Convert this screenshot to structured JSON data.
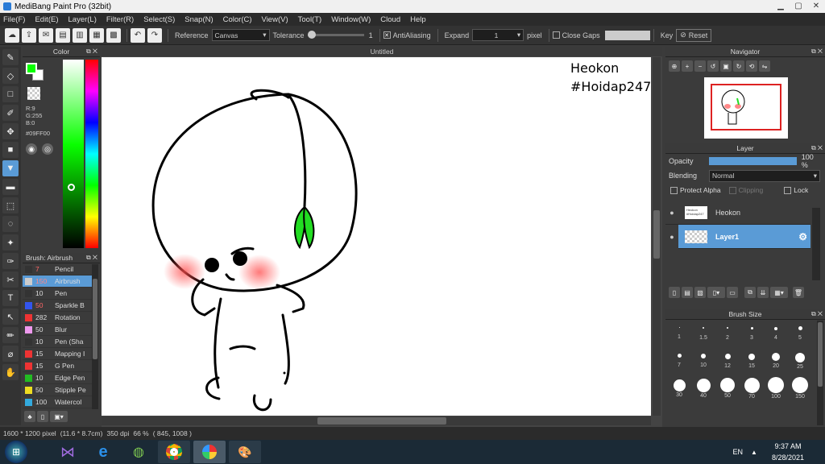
{
  "window": {
    "title": "MediBang Paint Pro (32bit)"
  },
  "menu": [
    "File(F)",
    "Edit(E)",
    "Layer(L)",
    "Filter(R)",
    "Select(S)",
    "Snap(N)",
    "Color(C)",
    "View(V)",
    "Tool(T)",
    "Window(W)",
    "Cloud",
    "Help"
  ],
  "toolbar": {
    "reference_label": "Reference",
    "reference_value": "Canvas",
    "tolerance_label": "Tolerance",
    "tolerance_value": "1",
    "tolerance_fraction": 0.01,
    "antialiasing_label": "AntiAliasing",
    "expand_label": "Expand",
    "expand_value": "1",
    "expand_unit": "pixel",
    "close_gaps_label": "Close Gaps",
    "key_label": "Key",
    "reset_label": "Reset"
  },
  "color_panel": {
    "title": "Color",
    "r": "R:9",
    "g": "G:255",
    "b": "B:0",
    "hex": "#09FF00",
    "current_color": "#09ff00"
  },
  "brush_panel": {
    "title": "Brush: Airbrush",
    "items": [
      {
        "size": "7",
        "name": "Pencil",
        "color": "#333333"
      },
      {
        "size": "150",
        "name": "Airbrush",
        "color": "#cccccc"
      },
      {
        "size": "10",
        "name": "Pen",
        "color": "#333333"
      },
      {
        "size": "50",
        "name": "Sparkle B",
        "color": "#3355ee"
      },
      {
        "size": "282",
        "name": "Rotation",
        "color": "#ee3333"
      },
      {
        "size": "50",
        "name": "Blur",
        "color": "#ee99ee"
      },
      {
        "size": "10",
        "name": "Pen (Sha",
        "color": "#333333"
      },
      {
        "size": "15",
        "name": "Mapping I",
        "color": "#ee3333"
      },
      {
        "size": "15",
        "name": "G Pen",
        "color": "#ee3333"
      },
      {
        "size": "10",
        "name": "Edge Pen",
        "color": "#22bb22"
      },
      {
        "size": "50",
        "name": "Stipple Pe",
        "color": "#eedd22"
      },
      {
        "size": "100",
        "name": "Watercol",
        "color": "#33aadd"
      }
    ]
  },
  "document": {
    "tab": "Untitled",
    "caption_line1": "Heokon",
    "caption_line2": "#Hoidap247"
  },
  "navigator": {
    "title": "Navigator"
  },
  "layer_panel": {
    "title": "Layer",
    "opacity_label": "Opacity",
    "opacity_value": "100 %",
    "opacity_fraction": 1.0,
    "blending_label": "Blending",
    "blending_value": "Normal",
    "protect_alpha": "Protect Alpha",
    "clipping": "Clipping",
    "lock": "Lock",
    "layers": [
      {
        "name": "Heokon",
        "thumb_text": "Heokon #Hoidap247"
      },
      {
        "name": "Layer1"
      }
    ]
  },
  "brush_size_panel": {
    "title": "Brush Size",
    "sizes": [
      "1",
      "1.5",
      "2",
      "3",
      "4",
      "5",
      "7",
      "10",
      "12",
      "15",
      "20",
      "25",
      "30",
      "40",
      "50",
      "70",
      "100",
      "150"
    ]
  },
  "statusbar": {
    "size": "1600 * 1200 pixel",
    "cm": "(11.6 * 8.7cm)",
    "dpi": "350 dpi",
    "zoom": "66 %",
    "coords": "( 845, 1008 )"
  },
  "taskbar": {
    "lang": "EN",
    "time": "9:37 AM",
    "date": "8/28/2021"
  },
  "colors": {
    "accent": "#5a9bd6",
    "panel": "#3b3b3b",
    "dark": "#2b2b2b"
  }
}
